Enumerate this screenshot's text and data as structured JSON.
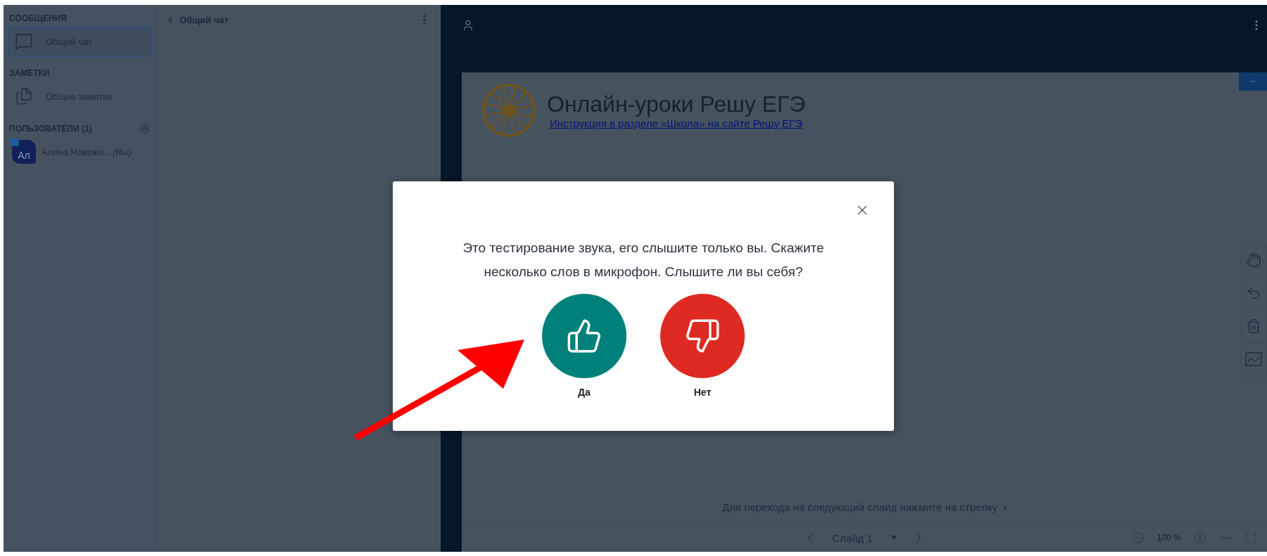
{
  "sidebar": {
    "sections": [
      {
        "title": "СООБЩЕНИЯ",
        "items": [
          {
            "label": "Общий чат",
            "kind": "chat",
            "selected": true
          }
        ]
      },
      {
        "title": "ЗАМЕТКИ",
        "items": [
          {
            "label": "Общие заметки",
            "kind": "notes",
            "selected": false
          }
        ]
      }
    ],
    "users": {
      "title": "ПОЛЬЗОВАТЕЛИ (1)",
      "list": [
        {
          "initials": "Ал",
          "name": "Алина Новожи…",
          "suffix": "(Вы)"
        }
      ]
    }
  },
  "chat": {
    "title": "Общий чат"
  },
  "slide": {
    "title": "Онлайн-уроки Решу ЕГЭ",
    "link": "Инструкция в разделе «Школа» на сайте Решу ЕГЭ",
    "hint": "Для перехода на следующий слайд нажмите на стрелку",
    "hint_arrow": "›"
  },
  "slide_controls": {
    "slide": "Слайд 1",
    "zoom": "100 %"
  },
  "modal": {
    "message": "Это тестирование звука, его слышите только вы. Скажите несколько слов в микрофон. Слышите ли вы себя?",
    "buttons": [
      {
        "label": "Да",
        "kind": "yes"
      },
      {
        "label": "Нет",
        "kind": "no"
      }
    ]
  }
}
